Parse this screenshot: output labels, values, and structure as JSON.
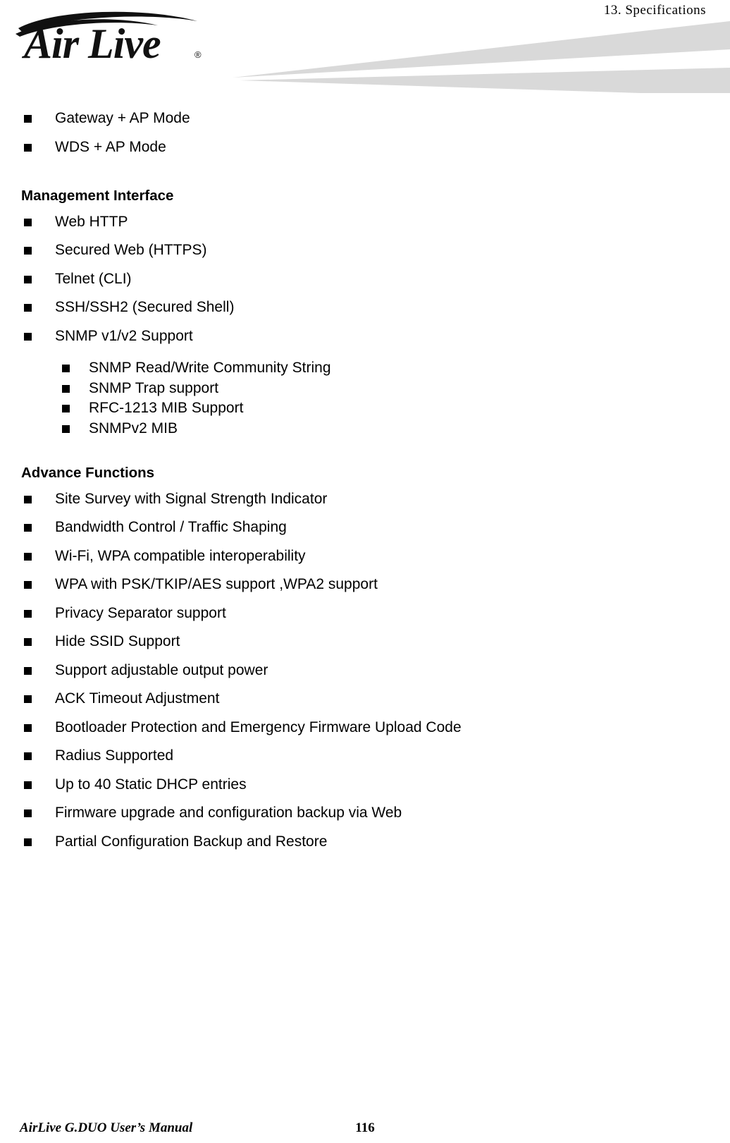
{
  "header": {
    "chapter": "13.  Specifications",
    "logo_text": "Air Live",
    "logo_registered": "®"
  },
  "content": {
    "top_items": [
      "Gateway + AP Mode",
      "WDS + AP Mode"
    ],
    "sections": [
      {
        "heading": "Management Interface",
        "items": [
          "Web HTTP",
          "Secured Web (HTTPS)",
          "Telnet (CLI)",
          "SSH/SSH2 (Secured Shell)",
          "SNMP v1/v2 Support"
        ],
        "sub_items": [
          "SNMP Read/Write Community String",
          "SNMP Trap support",
          "RFC-1213 MIB Support",
          "SNMPv2 MIB"
        ]
      },
      {
        "heading": "Advance Functions",
        "items": [
          "Site Survey with Signal Strength Indicator",
          "Bandwidth Control / Traffic Shaping",
          "Wi-Fi, WPA compatible interoperability",
          "WPA with PSK/TKIP/AES support ,WPA2 support",
          "Privacy Separator support",
          "Hide SSID Support",
          "Support adjustable output power",
          "ACK Timeout Adjustment",
          "Bootloader Protection and Emergency Firmware Upload Code",
          "Radius Supported",
          "Up to 40 Static DHCP entries",
          "Firmware upgrade and configuration backup via Web",
          "Partial Configuration Backup and Restore"
        ],
        "sub_items": []
      }
    ]
  },
  "footer": {
    "manual_title": "AirLive G.DUO User’s Manual",
    "page_number": "116"
  },
  "colors": {
    "swoosh": "#d9d9d9",
    "text": "#000000",
    "background": "#ffffff"
  }
}
